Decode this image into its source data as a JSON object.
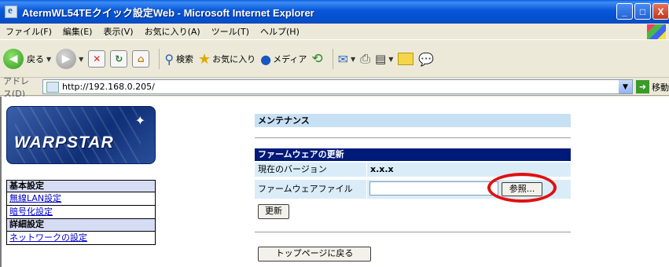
{
  "window": {
    "title": "AtermWL54TEクイック設定Web - Microsoft Internet Explorer",
    "buttons": [
      "_",
      "□",
      "X"
    ]
  },
  "menu": [
    "ファイル(F)",
    "編集(E)",
    "表示(V)",
    "お気に入り(A)",
    "ツール(T)",
    "ヘルプ(H)"
  ],
  "toolbar": {
    "back_label": "戻る",
    "search_label": "検索",
    "favorites_label": "お気に入り",
    "media_label": "メディア"
  },
  "address": {
    "label": "アドレス(D)",
    "url": "http://192.168.0.205/",
    "go_label": "移動"
  },
  "sidebar": {
    "logo_text": "WARPSTAR",
    "sections": [
      {
        "header": "基本設定",
        "items": [
          "無線LAN設定",
          "暗号化設定"
        ]
      },
      {
        "header": "詳細設定",
        "items": [
          "ネットワークの設定"
        ]
      }
    ]
  },
  "main": {
    "section_title": "メンテナンス",
    "firmware_header": "ファームウェアの更新",
    "version_label": "現在のバージョン",
    "version_value": "x.x.x",
    "file_label": "ファームウェアファイル",
    "browse_label": "参照...",
    "update_label": "更新",
    "top_page_label": "トップページに戻る"
  },
  "colors": {
    "titlebar": "#0450cf",
    "section_bar": "#c8e0f4",
    "header_dark": "#001a7a",
    "row_bg": "#d9ecf8",
    "highlight_circle": "#e01010"
  }
}
